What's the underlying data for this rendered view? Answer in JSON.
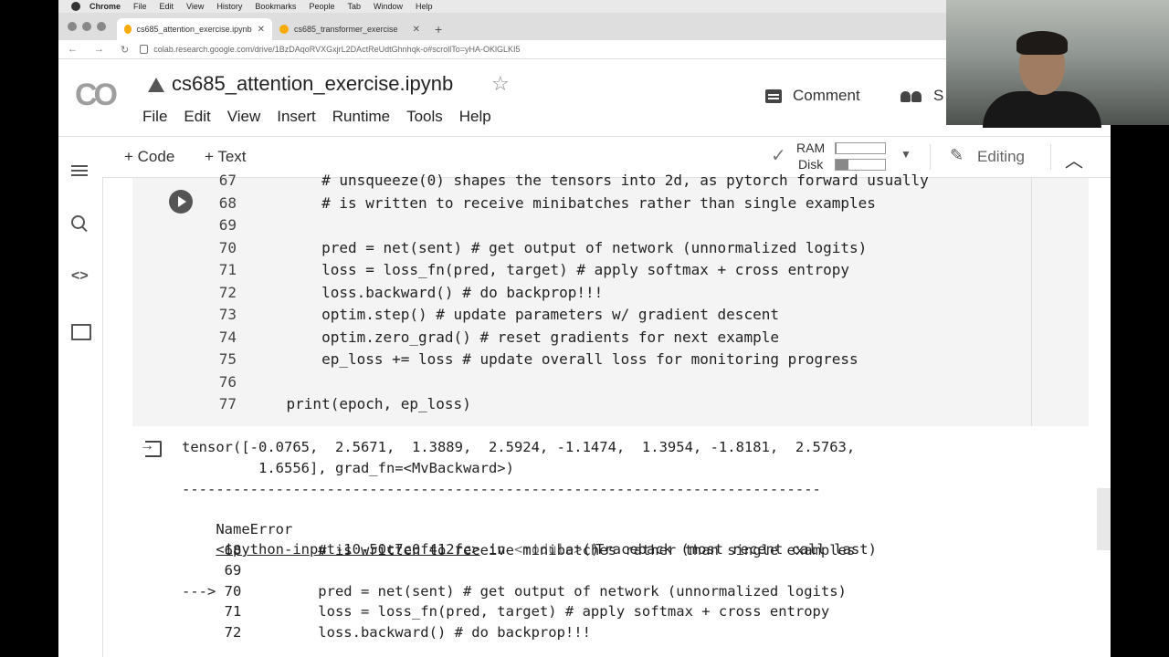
{
  "mac_menu": {
    "app": "Chrome",
    "items": [
      "File",
      "Edit",
      "View",
      "History",
      "Bookmarks",
      "People",
      "Tab",
      "Window",
      "Help"
    ]
  },
  "browser": {
    "tabs": [
      {
        "label": "cs685_attention_exercise.ipynb",
        "active": true
      },
      {
        "label": "cs685_transformer_exercise",
        "active": false
      }
    ],
    "url": "colab.research.google.com/drive/1BzDAqoRVXGxjrL2DActReUdtGhnhqk-o#scrollTo=yHA-OKlGLKI5"
  },
  "colab": {
    "logo": "CO",
    "notebook_title": "cs685_attention_exercise.ipynb",
    "menu": [
      "File",
      "Edit",
      "View",
      "Insert",
      "Runtime",
      "Tools",
      "Help"
    ],
    "comment_label": "Comment",
    "share_label": "S"
  },
  "toolbar": {
    "add_code": "+ Code",
    "add_text": "+ Text",
    "ram_label": "RAM",
    "disk_label": "Disk",
    "ram_usage": 0.02,
    "disk_usage": 0.25,
    "editing_label": "Editing"
  },
  "code_cell": {
    "lines": [
      {
        "num": "67",
        "code": "        # unsqueeze(0) shapes the tensors into 2d, as pytorch forward usually"
      },
      {
        "num": "68",
        "code": "        # is written to receive minibatches rather than single examples"
      },
      {
        "num": "69",
        "code": ""
      },
      {
        "num": "70",
        "code": "        pred = net(sent) # get output of network (unnormalized logits)"
      },
      {
        "num": "71",
        "code": "        loss = loss_fn(pred, target) # apply softmax + cross entropy"
      },
      {
        "num": "72",
        "code": "        loss.backward() # do backprop!!!"
      },
      {
        "num": "73",
        "code": "        optim.step() # update parameters w/ gradient descent"
      },
      {
        "num": "74",
        "code": "        optim.zero_grad() # reset gradients for next example"
      },
      {
        "num": "75",
        "code": "        ep_loss += loss # update overall loss for monitoring progress"
      },
      {
        "num": "76",
        "code": ""
      },
      {
        "num": "77",
        "code": "    print(epoch, ep_loss)"
      }
    ]
  },
  "output": {
    "tensor_line1": "tensor([-0.0765,  2.5671,  1.3889,  2.5924, -1.1474,  1.3954, -1.8181,  2.5763,",
    "tensor_line2": "         1.6556], grad_fn=<MvBackward>)",
    "separator": "---------------------------------------------------------------------------",
    "error_name": "NameError",
    "traceback_header": "Traceback (most recent call last)",
    "input_link": "<ipython-input-10-50c7c0f412fc>",
    "in_word": " in ",
    "module": "<module>",
    "module_suffix": "()",
    "trace_lines": [
      "     68         # is written to receive minibatches rather than single examples",
      "     69 ",
      "---> 70         pred = net(sent) # get output of network (unnormalized logits)",
      "     71         loss = loss_fn(pred, target) # apply softmax + cross entropy",
      "     72         loss.backward() # do backprop!!!"
    ]
  }
}
